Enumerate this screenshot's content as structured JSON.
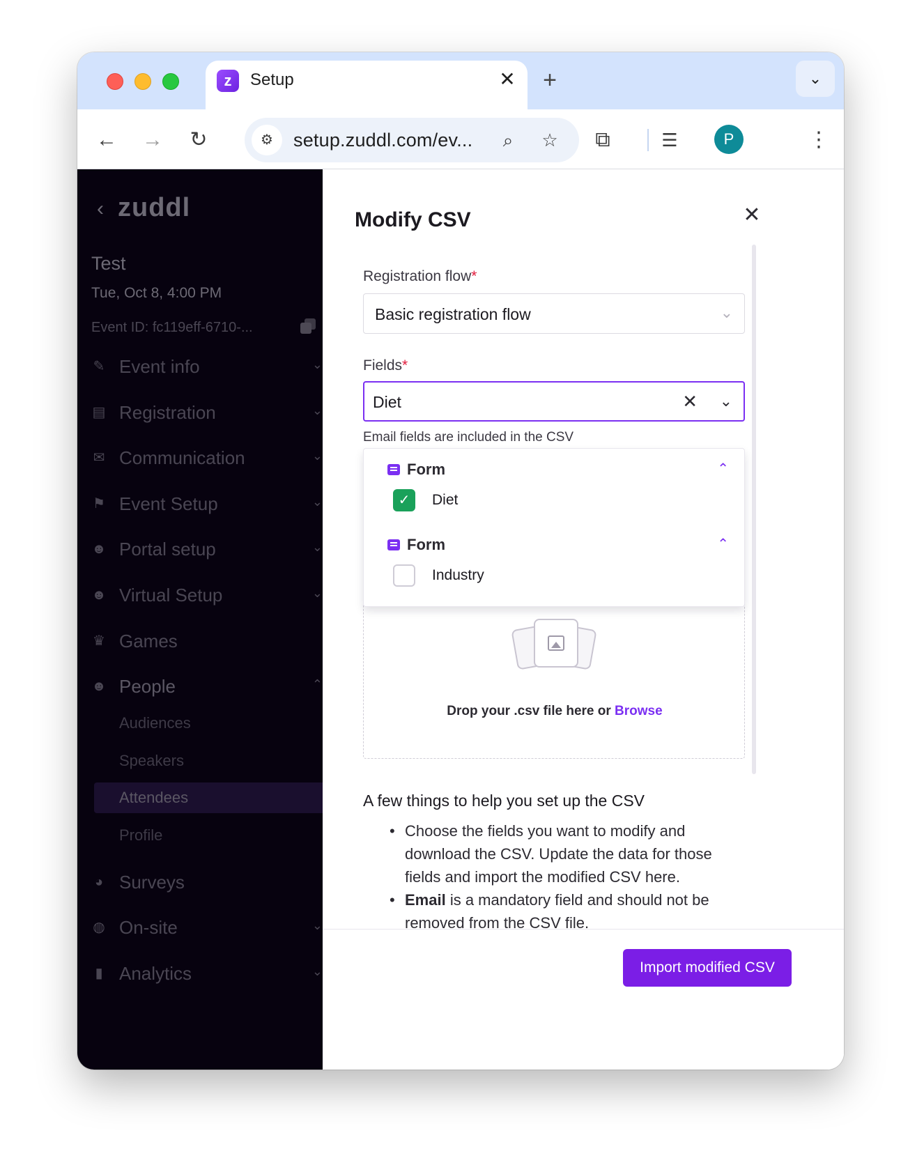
{
  "browser": {
    "tab_title": "Setup",
    "tab_favicon_letter": "z",
    "url": "setup.zuddl.com/ev...",
    "profile_initial": "P"
  },
  "sidebar": {
    "logo": "zuddl",
    "event_name": "Test",
    "event_date": "Tue, Oct 8, 4:00 PM",
    "event_id": "Event ID: fc119eff-6710-...",
    "items": [
      {
        "label": "Event info",
        "icon": "magic-wand-icon"
      },
      {
        "label": "Registration",
        "icon": "form-icon"
      },
      {
        "label": "Communication",
        "icon": "mail-icon"
      },
      {
        "label": "Event Setup",
        "icon": "signpost-icon"
      },
      {
        "label": "Portal setup",
        "icon": "user-icon"
      },
      {
        "label": "Virtual Setup",
        "icon": "user-icon"
      },
      {
        "label": "Games",
        "icon": "crown-icon"
      },
      {
        "label": "People",
        "icon": "user-icon"
      },
      {
        "label": "Surveys",
        "icon": "pie-icon"
      },
      {
        "label": "On-site",
        "icon": "compass-icon"
      },
      {
        "label": "Analytics",
        "icon": "bar-chart-icon"
      }
    ],
    "people_sub": [
      "Audiences",
      "Speakers",
      "Attendees",
      "Profile"
    ],
    "active_sub": "Attendees"
  },
  "panel": {
    "title": "Modify CSV",
    "registration_flow": {
      "label": "Registration flow",
      "required_mark": "*",
      "value": "Basic registration flow"
    },
    "fields": {
      "label": "Fields",
      "required_mark": "*",
      "value": "Diet",
      "hint": "Email fields are included in the CSV"
    },
    "dropdown_groups": [
      {
        "title": "Form",
        "options": [
          {
            "label": "Diet",
            "checked": true
          }
        ]
      },
      {
        "title": "Form",
        "options": [
          {
            "label": "Industry",
            "checked": false
          }
        ]
      }
    ],
    "dropzone": {
      "text": "Drop your .csv file here or",
      "browse": "Browse"
    },
    "help": {
      "title": "A few things to help you set up the CSV",
      "item1": "Choose the fields you want to modify and download the CSV. Update the data for those fields and import the modified CSV here.",
      "item2_bold": "Email",
      "item2_rest": " is a mandatory field and should not be removed from the CSV file."
    },
    "import_button": "Import modified CSV"
  },
  "colors": {
    "accent": "#7b1ee6",
    "sidebar_bg": "#07020f",
    "checkbox_checked": "#1aa15a",
    "required": "#e21b3c"
  }
}
